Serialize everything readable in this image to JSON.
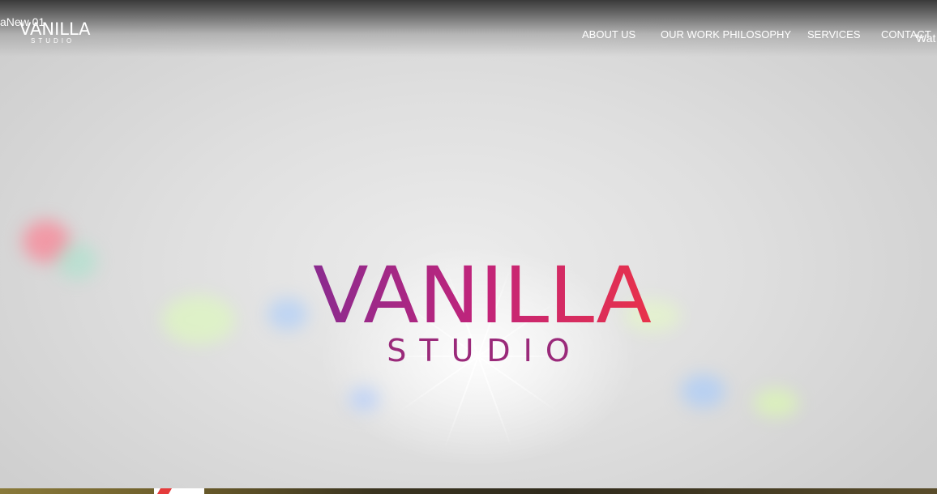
{
  "header": {
    "logo_word": "VANILLA",
    "logo_sub": "STUDIO",
    "overlay_left": "aNew 01",
    "overlay_right": "Wat"
  },
  "nav": {
    "items": [
      {
        "label": "ABOUT US"
      },
      {
        "label": "OUR WORK PHILOSOPHY"
      },
      {
        "label": "SERVICES"
      },
      {
        "label": "CONTACT"
      }
    ]
  },
  "hero": {
    "logo_word": "VANILLA",
    "logo_sub": "STUDIO",
    "colors": {
      "gradient_start": "#8a2b8f",
      "gradient_mid": "#c2247a",
      "gradient_end": "#e8324a",
      "sub_color": "#9a2a7a"
    }
  },
  "icons": {
    "hero_logo": "vanilla-studio-logo",
    "nav_logo": "vanilla-studio-logo"
  }
}
